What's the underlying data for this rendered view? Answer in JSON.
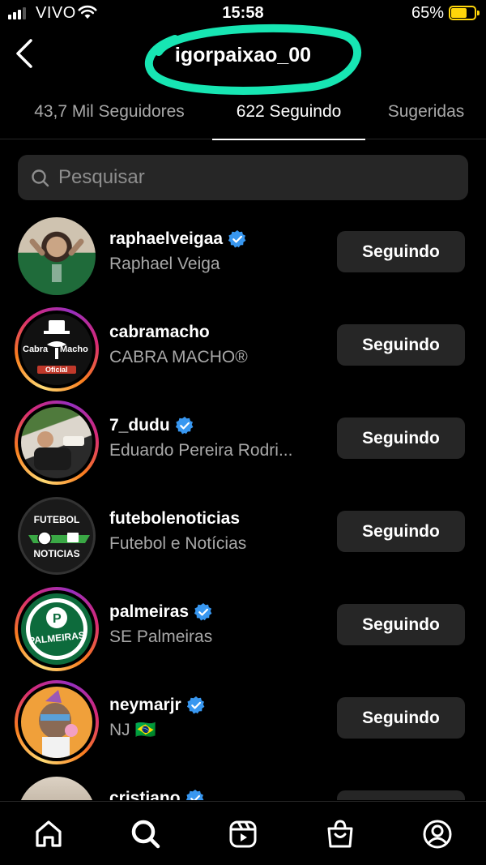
{
  "status_bar": {
    "carrier": "VIVO",
    "time": "15:58",
    "battery": "65%"
  },
  "header": {
    "username": "igorpaixao_00"
  },
  "tabs": [
    {
      "label": "43,7 Mil Seguidores"
    },
    {
      "label": "622 Seguindo"
    },
    {
      "label": "Sugeridas"
    }
  ],
  "search": {
    "placeholder": "Pesquisar"
  },
  "accounts": [
    {
      "username": "raphaelveigaa",
      "name": "Raphael Veiga",
      "button": "Seguindo"
    },
    {
      "username": "cabramacho",
      "name": "CABRA MACHO®",
      "button": "Seguindo"
    },
    {
      "username": "7_dudu",
      "name": "Eduardo Pereira Rodri...",
      "button": "Seguindo"
    },
    {
      "username": "futebolenoticias",
      "name": "Futebol e Notícias",
      "button": "Seguindo"
    },
    {
      "username": "palmeiras",
      "name": "SE Palmeiras",
      "button": "Seguindo"
    },
    {
      "username": "neymarjr",
      "name": "NJ 🇧🇷",
      "button": "Seguindo"
    },
    {
      "username": "cristiano",
      "name": "",
      "button": ""
    }
  ],
  "avatar_text": {
    "cabramacho_line1": "Cabra",
    "cabramacho_line2": "Macho",
    "cabramacho_line3": "Oficial",
    "futebol_top": "FUTEBOL",
    "futebol_bottom": "NOTICIAS",
    "palmeiras": "PALMEIRAS"
  },
  "colors": {
    "verified": "#3897f0",
    "button_bg": "#262626",
    "annotation": "#17e6b3"
  }
}
